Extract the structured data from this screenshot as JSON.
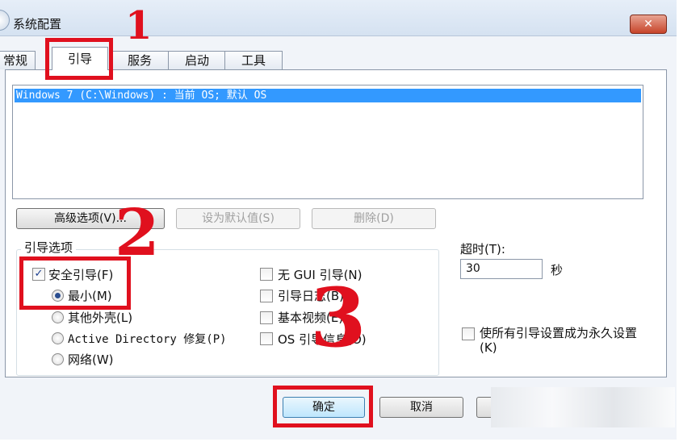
{
  "window": {
    "title": "系统配置",
    "close_label": "✕"
  },
  "tabs": [
    {
      "label": "常规",
      "active": false
    },
    {
      "label": "引导",
      "active": true
    },
    {
      "label": "服务",
      "active": false
    },
    {
      "label": "启动",
      "active": false
    },
    {
      "label": "工具",
      "active": false
    }
  ],
  "os_list": {
    "entries": [
      "Windows 7 (C:\\Windows) : 当前 OS; 默认 OS"
    ]
  },
  "list_buttons": {
    "advanced": "高级选项(V)...",
    "set_default": "设为默认值(S)",
    "delete": "删除(D)"
  },
  "boot_options": {
    "group_label": "引导选项",
    "safe_boot": {
      "label": "安全引导(F)",
      "checked": true
    },
    "modes": [
      {
        "label": "最小(M)",
        "selected": true
      },
      {
        "label": "其他外壳(L)",
        "selected": false
      },
      {
        "label": "Active Directory 修复(P)",
        "selected": false
      },
      {
        "label": "网络(W)",
        "selected": false
      }
    ],
    "extras": [
      {
        "label": "无 GUI 引导(N)",
        "checked": false
      },
      {
        "label": "引导日志(B)",
        "checked": false
      },
      {
        "label": "基本视频(E)",
        "checked": false
      },
      {
        "label": "OS 引导信息(O)",
        "checked": false
      }
    ]
  },
  "timeout": {
    "label": "超时(T):",
    "value": "30",
    "unit": "秒"
  },
  "permanent": {
    "label": "使所有引导设置成为永久设置(K)",
    "checked": false
  },
  "dialog_buttons": {
    "ok": "确定",
    "cancel": "取消"
  },
  "annotations": {
    "step1": "1",
    "step2": "2",
    "step3": "3",
    "color": "#e0101e"
  }
}
